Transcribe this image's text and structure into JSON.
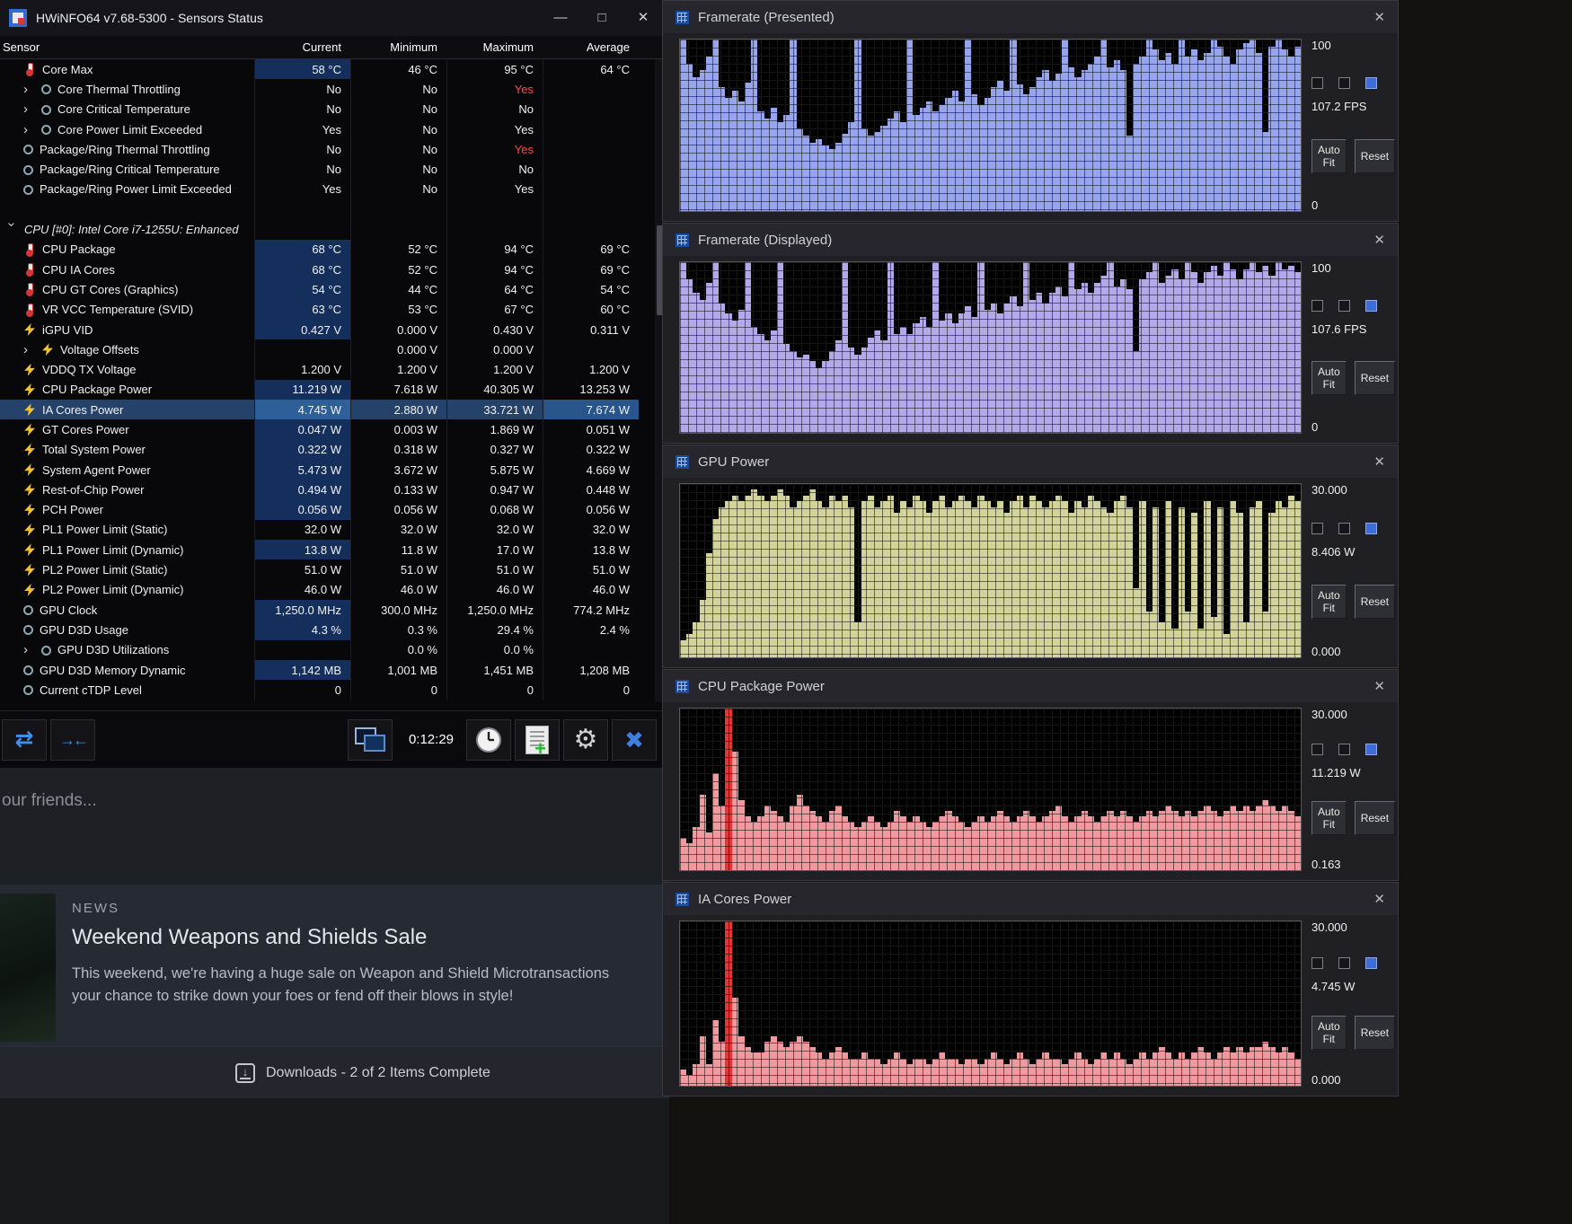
{
  "glyphs": {
    "close": "✕",
    "minimize": "—",
    "maximize": "□",
    "toolbar_close": "✖",
    "swap": "⇄",
    "merge": "→←",
    "gear": "⚙",
    "plus": "+",
    "down_arrow": "↓",
    "expand": "›"
  },
  "hwinfo": {
    "title": "HWiNFO64 v7.68-5300 - Sensors Status",
    "columns": [
      "Sensor",
      "Current",
      "Minimum",
      "Maximum",
      "Average"
    ],
    "toolbar": {
      "time": "0:12:29"
    },
    "rows": [
      {
        "icon": "temp",
        "name": "Core Max",
        "current": "58 °C",
        "min": "46 °C",
        "max": "95 °C",
        "avg": "64 °C",
        "hl": true
      },
      {
        "icon": "circle",
        "expand": true,
        "name": "Core Thermal Throttling",
        "current": "No",
        "min": "No",
        "max": "Yes",
        "avg": "",
        "red_max": true
      },
      {
        "icon": "circle",
        "expand": true,
        "name": "Core Critical Temperature",
        "current": "No",
        "min": "No",
        "max": "No",
        "avg": ""
      },
      {
        "icon": "circle",
        "expand": true,
        "name": "Core Power Limit Exceeded",
        "current": "Yes",
        "min": "No",
        "max": "Yes",
        "avg": ""
      },
      {
        "icon": "circle",
        "name": "Package/Ring Thermal Throttling",
        "current": "No",
        "min": "No",
        "max": "Yes",
        "avg": "",
        "red_max": true
      },
      {
        "icon": "circle",
        "name": "Package/Ring Critical Temperature",
        "current": "No",
        "min": "No",
        "max": "No",
        "avg": ""
      },
      {
        "icon": "circle",
        "name": "Package/Ring Power Limit Exceeded",
        "current": "Yes",
        "min": "No",
        "max": "Yes",
        "avg": ""
      },
      {
        "blank": true
      },
      {
        "section": true,
        "name": "CPU [#0]: Intel Core i7-1255U: Enhanced"
      },
      {
        "icon": "temp",
        "name": "CPU Package",
        "current": "68 °C",
        "min": "52 °C",
        "max": "94 °C",
        "avg": "69 °C",
        "hl": true
      },
      {
        "icon": "temp",
        "name": "CPU IA Cores",
        "current": "68 °C",
        "min": "52 °C",
        "max": "94 °C",
        "avg": "69 °C",
        "hl": true
      },
      {
        "icon": "temp",
        "name": "CPU GT Cores (Graphics)",
        "current": "54 °C",
        "min": "44 °C",
        "max": "64 °C",
        "avg": "54 °C",
        "hl": true
      },
      {
        "icon": "temp",
        "name": "VR VCC Temperature (SVID)",
        "current": "63 °C",
        "min": "53 °C",
        "max": "67 °C",
        "avg": "60 °C",
        "hl": true
      },
      {
        "icon": "bolt",
        "name": "iGPU VID",
        "current": "0.427 V",
        "min": "0.000 V",
        "max": "0.430 V",
        "avg": "0.311 V",
        "hl": true
      },
      {
        "icon": "bolt",
        "expand": true,
        "name": "Voltage Offsets",
        "current": "",
        "min": "0.000 V",
        "max": "0.000 V",
        "avg": ""
      },
      {
        "icon": "bolt",
        "name": "VDDQ TX Voltage",
        "current": "1.200 V",
        "min": "1.200 V",
        "max": "1.200 V",
        "avg": "1.200 V"
      },
      {
        "icon": "bolt",
        "name": "CPU Package Power",
        "current": "11.219 W",
        "min": "7.618 W",
        "max": "40.305 W",
        "avg": "13.253 W",
        "hl": true
      },
      {
        "icon": "bolt",
        "name": "IA Cores Power",
        "current": "4.745 W",
        "min": "2.880 W",
        "max": "33.721 W",
        "avg": "7.674 W",
        "hl": true,
        "selected": true,
        "avg_hl": true
      },
      {
        "icon": "bolt",
        "name": "GT Cores Power",
        "current": "0.047 W",
        "min": "0.003 W",
        "max": "1.869 W",
        "avg": "0.051 W",
        "hl": true
      },
      {
        "icon": "bolt",
        "name": "Total System Power",
        "current": "0.322 W",
        "min": "0.318 W",
        "max": "0.327 W",
        "avg": "0.322 W",
        "hl": true
      },
      {
        "icon": "bolt",
        "name": "System Agent Power",
        "current": "5.473 W",
        "min": "3.672 W",
        "max": "5.875 W",
        "avg": "4.669 W",
        "hl": true
      },
      {
        "icon": "bolt",
        "name": "Rest-of-Chip Power",
        "current": "0.494 W",
        "min": "0.133 W",
        "max": "0.947 W",
        "avg": "0.448 W",
        "hl": true
      },
      {
        "icon": "bolt",
        "name": "PCH Power",
        "current": "0.056 W",
        "min": "0.056 W",
        "max": "0.068 W",
        "avg": "0.056 W",
        "hl": true
      },
      {
        "icon": "bolt",
        "name": "PL1 Power Limit (Static)",
        "current": "32.0 W",
        "min": "32.0 W",
        "max": "32.0 W",
        "avg": "32.0 W"
      },
      {
        "icon": "bolt",
        "name": "PL1 Power Limit (Dynamic)",
        "current": "13.8 W",
        "min": "11.8 W",
        "max": "17.0 W",
        "avg": "13.8 W",
        "hl": true
      },
      {
        "icon": "bolt",
        "name": "PL2 Power Limit (Static)",
        "current": "51.0 W",
        "min": "51.0 W",
        "max": "51.0 W",
        "avg": "51.0 W"
      },
      {
        "icon": "bolt",
        "name": "PL2 Power Limit (Dynamic)",
        "current": "46.0 W",
        "min": "46.0 W",
        "max": "46.0 W",
        "avg": "46.0 W"
      },
      {
        "icon": "circle",
        "name": "GPU Clock",
        "current": "1,250.0 MHz",
        "min": "300.0 MHz",
        "max": "1,250.0 MHz",
        "avg": "774.2 MHz",
        "hl": true
      },
      {
        "icon": "circle",
        "name": "GPU D3D Usage",
        "current": "4.3 %",
        "min": "0.3 %",
        "max": "29.4 %",
        "avg": "2.4 %",
        "hl": true
      },
      {
        "icon": "circle",
        "expand": true,
        "name": "GPU D3D Utilizations",
        "current": "",
        "min": "0.0 %",
        "max": "0.0 %",
        "avg": ""
      },
      {
        "icon": "circle",
        "name": "GPU D3D Memory Dynamic",
        "current": "1,142 MB",
        "min": "1,001 MB",
        "max": "1,451 MB",
        "avg": "1,208 MB",
        "hl": true
      },
      {
        "icon": "circle",
        "name": "Current cTDP Level",
        "current": "0",
        "min": "0",
        "max": "0",
        "avg": "0"
      }
    ]
  },
  "panels": [
    {
      "title": "Framerate (Presented)",
      "ymax": "100",
      "current": "107.2 FPS",
      "ymin": "0",
      "autofit": "Auto Fit",
      "reset": "Reset"
    },
    {
      "title": "Framerate (Displayed)",
      "ymax": "100",
      "current": "107.6 FPS",
      "ymin": "0",
      "autofit": "Auto Fit",
      "reset": "Reset"
    },
    {
      "title": "GPU Power",
      "ymax": "30.000",
      "current": "8.406 W",
      "ymin": "0.000",
      "autofit": "Auto Fit",
      "reset": "Reset"
    },
    {
      "title": "CPU Package Power",
      "ymax": "30.000",
      "current": "11.219 W",
      "ymin": "0.163",
      "autofit": "Auto Fit",
      "reset": "Reset"
    },
    {
      "title": "IA Cores Power",
      "ymax": "30.000",
      "current": "4.745 W",
      "ymin": "0.000",
      "autofit": "Auto Fit",
      "reset": "Reset"
    }
  ],
  "chart_data": [
    {
      "type": "bar",
      "title": "Framerate (Presented)",
      "ylabel": "FPS",
      "ylim": [
        0,
        100
      ],
      "grid": true,
      "color": "#97a6ec",
      "values": [
        100,
        86,
        78,
        82,
        90,
        100,
        72,
        66,
        70,
        64,
        75,
        100,
        58,
        54,
        60,
        52,
        56,
        100,
        48,
        44,
        40,
        42,
        38,
        36,
        40,
        45,
        52,
        100,
        48,
        44,
        46,
        50,
        54,
        58,
        52,
        100,
        56,
        60,
        64,
        58,
        62,
        66,
        70,
        64,
        100,
        68,
        62,
        66,
        72,
        76,
        70,
        100,
        74,
        68,
        72,
        78,
        82,
        76,
        80,
        100,
        84,
        78,
        82,
        86,
        90,
        100,
        84,
        88,
        82,
        44,
        86,
        90,
        100,
        94,
        88,
        92,
        86,
        100,
        90,
        94,
        88,
        92,
        100,
        96,
        90,
        86,
        94,
        98,
        100,
        92,
        46,
        96,
        100,
        94,
        90,
        96
      ]
    },
    {
      "type": "bar",
      "title": "Framerate (Displayed)",
      "ylabel": "FPS",
      "ylim": [
        0,
        100
      ],
      "grid": true,
      "color": "#b2a8ea",
      "values": [
        100,
        90,
        82,
        78,
        88,
        100,
        76,
        70,
        66,
        72,
        100,
        62,
        58,
        54,
        60,
        100,
        52,
        48,
        44,
        46,
        42,
        38,
        42,
        48,
        54,
        100,
        50,
        46,
        50,
        56,
        60,
        54,
        100,
        58,
        62,
        58,
        64,
        68,
        62,
        100,
        66,
        70,
        64,
        70,
        74,
        68,
        100,
        72,
        76,
        70,
        76,
        80,
        74,
        100,
        78,
        82,
        76,
        82,
        86,
        80,
        100,
        84,
        88,
        82,
        88,
        92,
        100,
        86,
        90,
        84,
        48,
        90,
        94,
        100,
        88,
        92,
        96,
        90,
        100,
        94,
        88,
        94,
        98,
        92,
        100,
        96,
        90,
        96,
        100,
        94,
        98,
        92,
        100,
        96,
        98,
        94
      ]
    },
    {
      "type": "bar",
      "title": "GPU Power",
      "ylabel": "W",
      "ylim": [
        0,
        30
      ],
      "grid": true,
      "color": "#d3d39c",
      "values": [
        3,
        4,
        6,
        10,
        18,
        24,
        26,
        27,
        28,
        27,
        28,
        29,
        28,
        27,
        28,
        29,
        28,
        26,
        27,
        28,
        29,
        27,
        26,
        28,
        27,
        28,
        26,
        6,
        27,
        28,
        26,
        27,
        28,
        25,
        27,
        26,
        28,
        27,
        25,
        27,
        28,
        26,
        27,
        28,
        27,
        26,
        28,
        27,
        26,
        27,
        25,
        27,
        28,
        26,
        28,
        27,
        26,
        27,
        28,
        27,
        25,
        27,
        26,
        28,
        27,
        26,
        25,
        27,
        28,
        26,
        12,
        27,
        8,
        26,
        6,
        27,
        5,
        26,
        8,
        25,
        5,
        27,
        7,
        26,
        4,
        27,
        25,
        6,
        26,
        27,
        8,
        25,
        27,
        26,
        28,
        27
      ]
    },
    {
      "type": "bar",
      "title": "CPU Package Power",
      "ylabel": "W",
      "ylim": [
        0,
        30
      ],
      "grid": true,
      "color": "#f09aa0",
      "spike_color": "#e03838",
      "values": [
        6,
        5,
        8,
        14,
        7,
        18,
        12,
        30,
        22,
        13,
        10,
        9,
        10,
        12,
        11,
        10,
        9,
        12,
        14,
        12,
        11,
        10,
        9,
        11,
        12,
        10,
        9,
        8,
        9,
        10,
        9,
        8,
        9,
        11,
        10,
        9,
        10,
        9,
        8,
        9,
        10,
        11,
        10,
        9,
        8,
        9,
        10,
        9,
        10,
        11,
        10,
        9,
        10,
        11,
        10,
        9,
        10,
        11,
        12,
        10,
        9,
        10,
        11,
        10,
        9,
        10,
        11,
        10,
        11,
        10,
        9,
        10,
        11,
        10,
        11,
        12,
        11,
        10,
        11,
        10,
        11,
        12,
        11,
        10,
        11,
        12,
        11,
        12,
        11,
        12,
        13,
        12,
        11,
        12,
        11,
        10
      ]
    },
    {
      "type": "bar",
      "title": "IA Cores Power",
      "ylabel": "W",
      "ylim": [
        0,
        30
      ],
      "grid": true,
      "color": "#f09aa0",
      "spike_color": "#e03838",
      "values": [
        3,
        2,
        4,
        9,
        4,
        12,
        8,
        30,
        16,
        9,
        7,
        6,
        6,
        8,
        9,
        8,
        7,
        8,
        9,
        8,
        7,
        6,
        5,
        6,
        7,
        6,
        5,
        5,
        6,
        5,
        5,
        4,
        5,
        6,
        5,
        4,
        5,
        5,
        4,
        5,
        6,
        5,
        5,
        4,
        5,
        5,
        4,
        5,
        6,
        5,
        4,
        5,
        6,
        5,
        4,
        5,
        6,
        5,
        5,
        4,
        5,
        6,
        5,
        4,
        5,
        6,
        5,
        6,
        5,
        4,
        5,
        6,
        5,
        6,
        7,
        6,
        5,
        6,
        5,
        6,
        7,
        6,
        5,
        6,
        7,
        6,
        7,
        6,
        7,
        7,
        8,
        7,
        6,
        7,
        6,
        5
      ]
    }
  ],
  "steam": {
    "friends_text": "our friends...",
    "news_label": "NEWS",
    "headline": "Weekend Weapons and Shields Sale",
    "body_line1": "This weekend, we're having a huge sale on Weapon and Shield Microtransactions",
    "body_line2": "your chance to strike down your foes or fend off their blows in style!",
    "downloads_text": "Downloads - 2 of 2 Items Complete"
  }
}
